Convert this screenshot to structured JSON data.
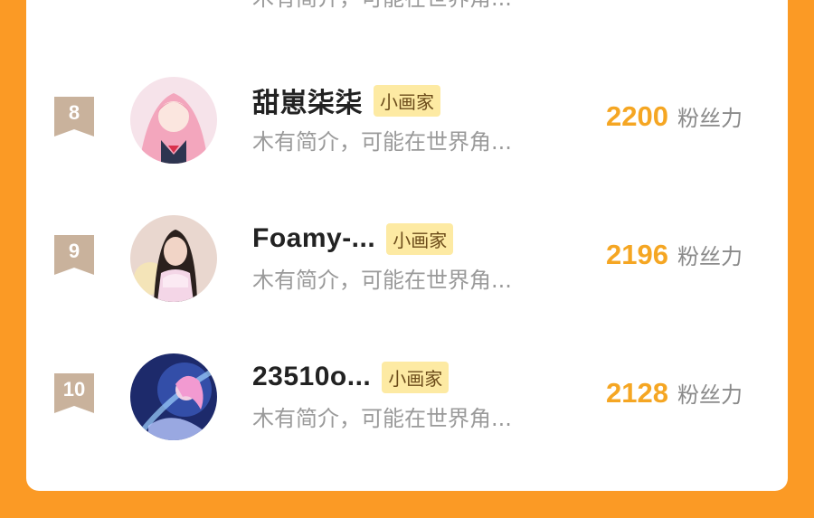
{
  "top_partial": {
    "bio": "木有简介，可能在世界角..."
  },
  "entries": [
    {
      "rank": "8",
      "name": "甜崽柒柒",
      "tag": "小画家",
      "bio": "木有简介，可能在世界角...",
      "score": "2200",
      "score_unit": "粉丝力"
    },
    {
      "rank": "9",
      "name": "Foamy-...",
      "tag": "小画家",
      "bio": "木有简介，可能在世界角...",
      "score": "2196",
      "score_unit": "粉丝力"
    },
    {
      "rank": "10",
      "name": "23510o...",
      "tag": "小画家",
      "bio": "木有简介，可能在世界角...",
      "score": "2128",
      "score_unit": "粉丝力"
    }
  ],
  "colors": {
    "background": "#fb9a25",
    "score": "#f5a623",
    "tag_bg": "#fdeaa3",
    "rank_badge": "#c9b29c"
  }
}
